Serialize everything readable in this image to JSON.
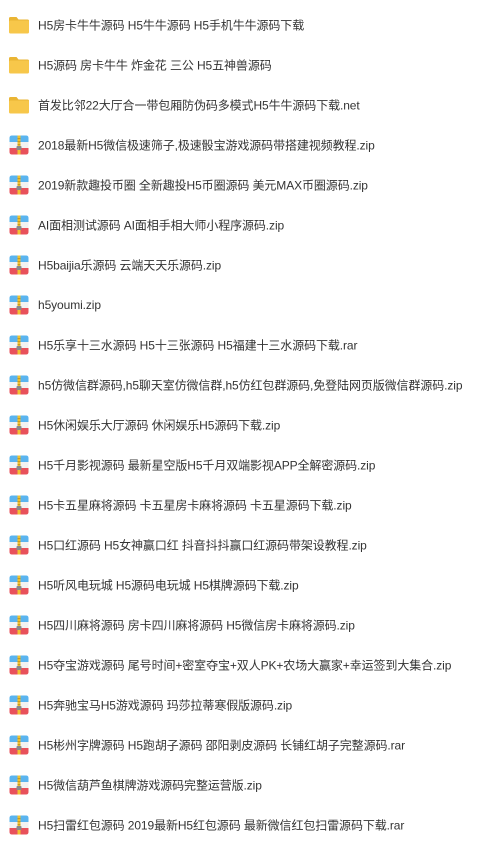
{
  "colors": {
    "folder": "#f7c74a",
    "folder_tab": "#eab534",
    "archive_top": "#5ab4ef",
    "archive_bottom": "#e8515b",
    "archive_mid": "#f2f2f2",
    "archive_zipper": "#f1c232",
    "text": "#333333"
  },
  "files": [
    {
      "type": "folder",
      "icon": "folder-icon",
      "name": "H5房卡牛牛源码 H5牛牛源码 H5手机牛牛源码下载"
    },
    {
      "type": "folder",
      "icon": "folder-icon",
      "name": "H5源码 房卡牛牛 炸金花 三公 H5五神兽源码"
    },
    {
      "type": "folder",
      "icon": "folder-icon",
      "name": "首发比邻22大厅合一带包厢防伪码多模式H5牛牛源码下载.net"
    },
    {
      "type": "archive",
      "icon": "archive-icon",
      "name": "2018最新H5微信极速筛子,极速骰宝游戏源码带搭建视频教程.zip"
    },
    {
      "type": "archive",
      "icon": "archive-icon",
      "name": "2019新款趣投币圈 全新趣投H5币圈源码 美元MAX币圈源码.zip"
    },
    {
      "type": "archive",
      "icon": "archive-icon",
      "name": "AI面相测试源码 AI面相手相大师小程序源码.zip"
    },
    {
      "type": "archive",
      "icon": "archive-icon",
      "name": "H5baijia乐源码 云端天天乐源码.zip"
    },
    {
      "type": "archive",
      "icon": "archive-icon",
      "name": "h5youmi.zip"
    },
    {
      "type": "archive",
      "icon": "archive-icon",
      "name": "H5乐享十三水源码 H5十三张源码 H5福建十三水源码下载.rar"
    },
    {
      "type": "archive",
      "icon": "archive-icon",
      "name": "h5仿微信群源码,h5聊天室仿微信群,h5仿红包群源码,免登陆网页版微信群源码.zip"
    },
    {
      "type": "archive",
      "icon": "archive-icon",
      "name": "H5休闲娱乐大厅源码 休闲娱乐H5源码下载.zip"
    },
    {
      "type": "archive",
      "icon": "archive-icon",
      "name": "H5千月影视源码 最新星空版H5千月双端影视APP全解密源码.zip"
    },
    {
      "type": "archive",
      "icon": "archive-icon",
      "name": "H5卡五星麻将源码 卡五星房卡麻将源码 卡五星源码下载.zip"
    },
    {
      "type": "archive",
      "icon": "archive-icon",
      "name": "H5口红源码 H5女神赢口红 抖音抖抖赢口红源码带架设教程.zip"
    },
    {
      "type": "archive",
      "icon": "archive-icon",
      "name": "H5听风电玩城 H5源码电玩城 H5棋牌源码下载.zip"
    },
    {
      "type": "archive",
      "icon": "archive-icon",
      "name": "H5四川麻将源码 房卡四川麻将源码 H5微信房卡麻将源码.zip"
    },
    {
      "type": "archive",
      "icon": "archive-icon",
      "name": "H5夺宝游戏源码 尾号时间+密室夺宝+双人PK+农场大赢家+幸运签到大集合.zip"
    },
    {
      "type": "archive",
      "icon": "archive-icon",
      "name": "H5奔驰宝马H5游戏源码 玛莎拉蒂寒假版源码.zip"
    },
    {
      "type": "archive",
      "icon": "archive-icon",
      "name": "H5彬州字牌源码 H5跑胡子源码 邵阳剥皮源码 长铺红胡子完整源码.rar"
    },
    {
      "type": "archive",
      "icon": "archive-icon",
      "name": "H5微信葫芦鱼棋牌游戏源码完整运营版.zip"
    },
    {
      "type": "archive",
      "icon": "archive-icon",
      "name": "H5扫雷红包源码 2019最新H5红包源码 最新微信红包扫雷源码下载.rar"
    }
  ]
}
